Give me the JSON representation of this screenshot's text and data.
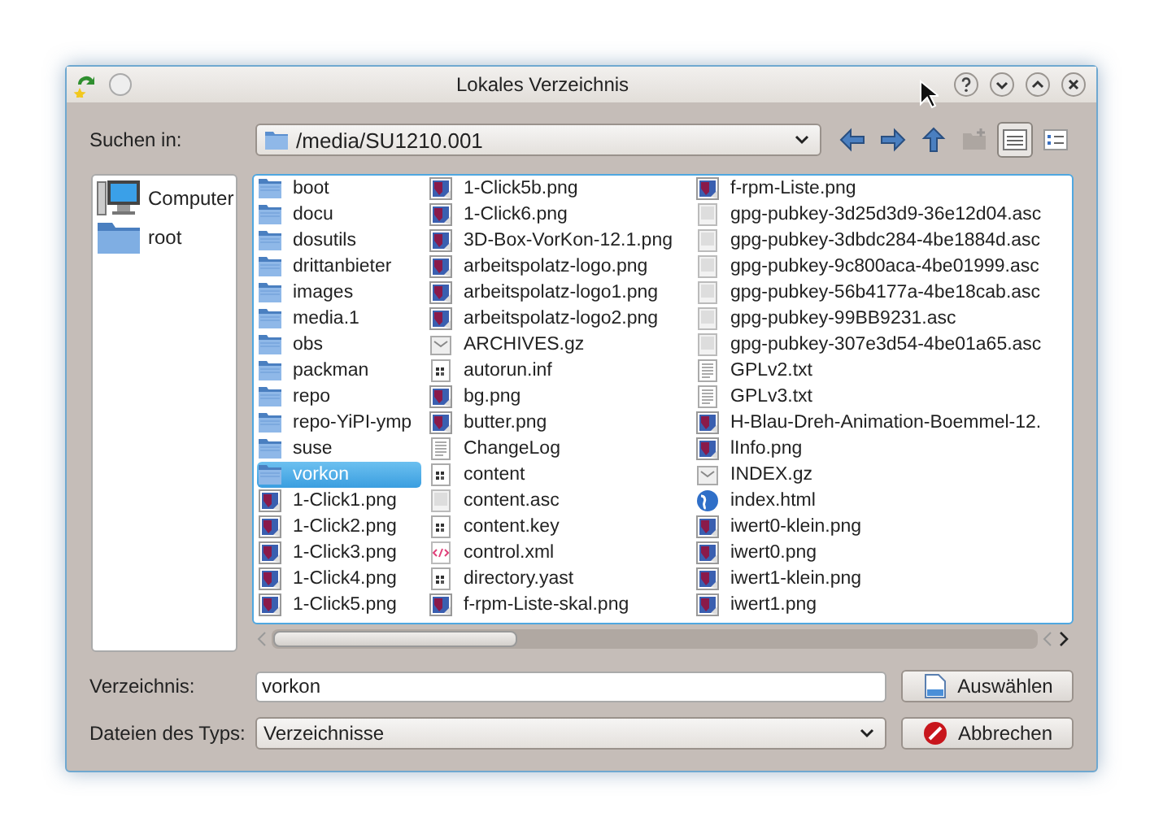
{
  "window": {
    "title": "Lokales Verzeichnis"
  },
  "location": {
    "label": "Suchen in:",
    "path": "/media/SU1210.001"
  },
  "toolbar": [
    {
      "kind": "back",
      "disabled": false,
      "pressed": false
    },
    {
      "kind": "forward",
      "disabled": false,
      "pressed": false
    },
    {
      "kind": "up",
      "disabled": false,
      "pressed": false
    },
    {
      "kind": "new-folder",
      "disabled": true,
      "pressed": false
    },
    {
      "kind": "detail-view",
      "disabled": false,
      "pressed": true
    },
    {
      "kind": "tree-view",
      "disabled": false,
      "pressed": false
    }
  ],
  "places": [
    {
      "label": "Computer",
      "kind": "computer"
    },
    {
      "label": "root",
      "kind": "folder"
    }
  ],
  "files": [
    {
      "name": "boot",
      "kind": "folder",
      "selected": false
    },
    {
      "name": "docu",
      "kind": "folder",
      "selected": false
    },
    {
      "name": "dosutils",
      "kind": "folder",
      "selected": false
    },
    {
      "name": "drittanbieter",
      "kind": "folder",
      "selected": false
    },
    {
      "name": "images",
      "kind": "folder",
      "selected": false
    },
    {
      "name": "media.1",
      "kind": "folder",
      "selected": false
    },
    {
      "name": "obs",
      "kind": "folder",
      "selected": false
    },
    {
      "name": "packman",
      "kind": "folder",
      "selected": false
    },
    {
      "name": "repo",
      "kind": "folder",
      "selected": false
    },
    {
      "name": "repo-YiPI-ymp",
      "kind": "folder",
      "selected": false
    },
    {
      "name": "suse",
      "kind": "folder",
      "selected": false
    },
    {
      "name": "vorkon",
      "kind": "folder",
      "selected": true
    },
    {
      "name": "1-Click1.png",
      "kind": "image",
      "selected": false
    },
    {
      "name": "1-Click2.png",
      "kind": "image",
      "selected": false
    },
    {
      "name": "1-Click3.png",
      "kind": "image",
      "selected": false
    },
    {
      "name": "1-Click4.png",
      "kind": "image",
      "selected": false
    },
    {
      "name": "1-Click5.png",
      "kind": "image",
      "selected": false
    },
    {
      "name": "1-Click5b.png",
      "kind": "image",
      "selected": false
    },
    {
      "name": "1-Click6.png",
      "kind": "image",
      "selected": false
    },
    {
      "name": "3D-Box-VorKon-12.1.png",
      "kind": "image",
      "selected": false
    },
    {
      "name": "arbeitspolatz-logo.png",
      "kind": "image",
      "selected": false
    },
    {
      "name": "arbeitspolatz-logo1.png",
      "kind": "image",
      "selected": false
    },
    {
      "name": "arbeitspolatz-logo2.png",
      "kind": "image",
      "selected": false
    },
    {
      "name": "ARCHIVES.gz",
      "kind": "archive",
      "selected": false
    },
    {
      "name": "autorun.inf",
      "kind": "config",
      "selected": false
    },
    {
      "name": "bg.png",
      "kind": "image",
      "selected": false
    },
    {
      "name": "butter.png",
      "kind": "image",
      "selected": false
    },
    {
      "name": "ChangeLog",
      "kind": "text",
      "selected": false
    },
    {
      "name": "content",
      "kind": "config",
      "selected": false
    },
    {
      "name": "content.asc",
      "kind": "document",
      "selected": false
    },
    {
      "name": "content.key",
      "kind": "config",
      "selected": false
    },
    {
      "name": "control.xml",
      "kind": "xml",
      "selected": false
    },
    {
      "name": "directory.yast",
      "kind": "config",
      "selected": false
    },
    {
      "name": "f-rpm-Liste-skal.png",
      "kind": "image",
      "selected": false
    },
    {
      "name": "f-rpm-Liste.png",
      "kind": "image",
      "selected": false
    },
    {
      "name": "gpg-pubkey-3d25d3d9-36e12d04.asc",
      "kind": "document",
      "selected": false
    },
    {
      "name": "gpg-pubkey-3dbdc284-4be1884d.asc",
      "kind": "document",
      "selected": false
    },
    {
      "name": "gpg-pubkey-9c800aca-4be01999.asc",
      "kind": "document",
      "selected": false
    },
    {
      "name": "gpg-pubkey-56b4177a-4be18cab.asc",
      "kind": "document",
      "selected": false
    },
    {
      "name": "gpg-pubkey-99BB9231.asc",
      "kind": "document",
      "selected": false
    },
    {
      "name": "gpg-pubkey-307e3d54-4be01a65.asc",
      "kind": "document",
      "selected": false
    },
    {
      "name": "GPLv2.txt",
      "kind": "text",
      "selected": false
    },
    {
      "name": "GPLv3.txt",
      "kind": "text",
      "selected": false
    },
    {
      "name": "H-Blau-Dreh-Animation-Boemmel-12.",
      "kind": "image",
      "selected": false
    },
    {
      "name": "lInfo.png",
      "kind": "image",
      "selected": false
    },
    {
      "name": "INDEX.gz",
      "kind": "archive",
      "selected": false
    },
    {
      "name": "index.html",
      "kind": "html",
      "selected": false
    },
    {
      "name": "iwert0-klein.png",
      "kind": "image",
      "selected": false
    },
    {
      "name": "iwert0.png",
      "kind": "image",
      "selected": false
    },
    {
      "name": "iwert1-klein.png",
      "kind": "image",
      "selected": false
    },
    {
      "name": "iwert1.png",
      "kind": "image",
      "selected": false
    }
  ],
  "directory": {
    "label": "Verzeichnis:",
    "value": "vorkon"
  },
  "filter": {
    "label": "Dateien des Typs:",
    "value": "Verzeichnisse"
  },
  "buttons": [
    {
      "label": "Auswählen",
      "kind": "select"
    },
    {
      "label": "Abbrechen",
      "kind": "cancel"
    }
  ]
}
